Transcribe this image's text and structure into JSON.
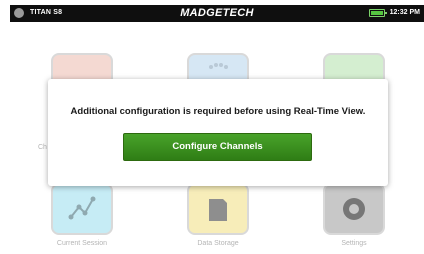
{
  "status_bar": {
    "device_name": "TITAN S8",
    "brand": "MADGETECH",
    "time": "12:32 PM",
    "battery_color": "#55c640",
    "power_icon": "power-indicator-icon"
  },
  "home": {
    "tiles": [
      {
        "icon": "graph-icon",
        "label": "Current Session"
      },
      {
        "icon": "data-storage-icon",
        "label": "Data Storage"
      },
      {
        "icon": "settings-icon",
        "label": "Settings"
      }
    ],
    "partial_label": "Ch"
  },
  "dialog": {
    "message": "Additional configuration is required before using Real-Time View.",
    "button_label": "Configure Channels",
    "button_color": "#3a8e1e"
  }
}
